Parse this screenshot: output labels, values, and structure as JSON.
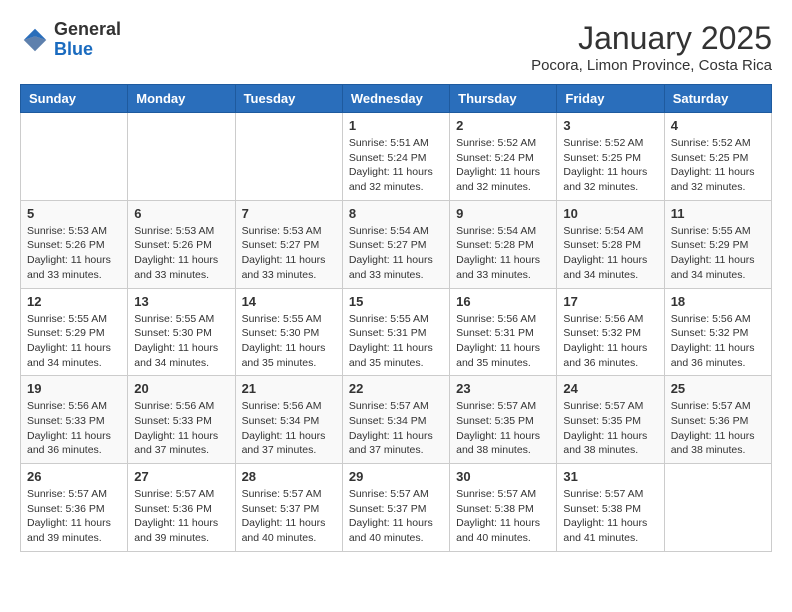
{
  "header": {
    "logo_general": "General",
    "logo_blue": "Blue",
    "month_title": "January 2025",
    "subtitle": "Pocora, Limon Province, Costa Rica"
  },
  "days_of_week": [
    "Sunday",
    "Monday",
    "Tuesday",
    "Wednesday",
    "Thursday",
    "Friday",
    "Saturday"
  ],
  "weeks": [
    [
      {
        "day": "",
        "sunrise": "",
        "sunset": "",
        "daylight": ""
      },
      {
        "day": "",
        "sunrise": "",
        "sunset": "",
        "daylight": ""
      },
      {
        "day": "",
        "sunrise": "",
        "sunset": "",
        "daylight": ""
      },
      {
        "day": "1",
        "sunrise": "Sunrise: 5:51 AM",
        "sunset": "Sunset: 5:24 PM",
        "daylight": "Daylight: 11 hours and 32 minutes."
      },
      {
        "day": "2",
        "sunrise": "Sunrise: 5:52 AM",
        "sunset": "Sunset: 5:24 PM",
        "daylight": "Daylight: 11 hours and 32 minutes."
      },
      {
        "day": "3",
        "sunrise": "Sunrise: 5:52 AM",
        "sunset": "Sunset: 5:25 PM",
        "daylight": "Daylight: 11 hours and 32 minutes."
      },
      {
        "day": "4",
        "sunrise": "Sunrise: 5:52 AM",
        "sunset": "Sunset: 5:25 PM",
        "daylight": "Daylight: 11 hours and 32 minutes."
      }
    ],
    [
      {
        "day": "5",
        "sunrise": "Sunrise: 5:53 AM",
        "sunset": "Sunset: 5:26 PM",
        "daylight": "Daylight: 11 hours and 33 minutes."
      },
      {
        "day": "6",
        "sunrise": "Sunrise: 5:53 AM",
        "sunset": "Sunset: 5:26 PM",
        "daylight": "Daylight: 11 hours and 33 minutes."
      },
      {
        "day": "7",
        "sunrise": "Sunrise: 5:53 AM",
        "sunset": "Sunset: 5:27 PM",
        "daylight": "Daylight: 11 hours and 33 minutes."
      },
      {
        "day": "8",
        "sunrise": "Sunrise: 5:54 AM",
        "sunset": "Sunset: 5:27 PM",
        "daylight": "Daylight: 11 hours and 33 minutes."
      },
      {
        "day": "9",
        "sunrise": "Sunrise: 5:54 AM",
        "sunset": "Sunset: 5:28 PM",
        "daylight": "Daylight: 11 hours and 33 minutes."
      },
      {
        "day": "10",
        "sunrise": "Sunrise: 5:54 AM",
        "sunset": "Sunset: 5:28 PM",
        "daylight": "Daylight: 11 hours and 34 minutes."
      },
      {
        "day": "11",
        "sunrise": "Sunrise: 5:55 AM",
        "sunset": "Sunset: 5:29 PM",
        "daylight": "Daylight: 11 hours and 34 minutes."
      }
    ],
    [
      {
        "day": "12",
        "sunrise": "Sunrise: 5:55 AM",
        "sunset": "Sunset: 5:29 PM",
        "daylight": "Daylight: 11 hours and 34 minutes."
      },
      {
        "day": "13",
        "sunrise": "Sunrise: 5:55 AM",
        "sunset": "Sunset: 5:30 PM",
        "daylight": "Daylight: 11 hours and 34 minutes."
      },
      {
        "day": "14",
        "sunrise": "Sunrise: 5:55 AM",
        "sunset": "Sunset: 5:30 PM",
        "daylight": "Daylight: 11 hours and 35 minutes."
      },
      {
        "day": "15",
        "sunrise": "Sunrise: 5:55 AM",
        "sunset": "Sunset: 5:31 PM",
        "daylight": "Daylight: 11 hours and 35 minutes."
      },
      {
        "day": "16",
        "sunrise": "Sunrise: 5:56 AM",
        "sunset": "Sunset: 5:31 PM",
        "daylight": "Daylight: 11 hours and 35 minutes."
      },
      {
        "day": "17",
        "sunrise": "Sunrise: 5:56 AM",
        "sunset": "Sunset: 5:32 PM",
        "daylight": "Daylight: 11 hours and 36 minutes."
      },
      {
        "day": "18",
        "sunrise": "Sunrise: 5:56 AM",
        "sunset": "Sunset: 5:32 PM",
        "daylight": "Daylight: 11 hours and 36 minutes."
      }
    ],
    [
      {
        "day": "19",
        "sunrise": "Sunrise: 5:56 AM",
        "sunset": "Sunset: 5:33 PM",
        "daylight": "Daylight: 11 hours and 36 minutes."
      },
      {
        "day": "20",
        "sunrise": "Sunrise: 5:56 AM",
        "sunset": "Sunset: 5:33 PM",
        "daylight": "Daylight: 11 hours and 37 minutes."
      },
      {
        "day": "21",
        "sunrise": "Sunrise: 5:56 AM",
        "sunset": "Sunset: 5:34 PM",
        "daylight": "Daylight: 11 hours and 37 minutes."
      },
      {
        "day": "22",
        "sunrise": "Sunrise: 5:57 AM",
        "sunset": "Sunset: 5:34 PM",
        "daylight": "Daylight: 11 hours and 37 minutes."
      },
      {
        "day": "23",
        "sunrise": "Sunrise: 5:57 AM",
        "sunset": "Sunset: 5:35 PM",
        "daylight": "Daylight: 11 hours and 38 minutes."
      },
      {
        "day": "24",
        "sunrise": "Sunrise: 5:57 AM",
        "sunset": "Sunset: 5:35 PM",
        "daylight": "Daylight: 11 hours and 38 minutes."
      },
      {
        "day": "25",
        "sunrise": "Sunrise: 5:57 AM",
        "sunset": "Sunset: 5:36 PM",
        "daylight": "Daylight: 11 hours and 38 minutes."
      }
    ],
    [
      {
        "day": "26",
        "sunrise": "Sunrise: 5:57 AM",
        "sunset": "Sunset: 5:36 PM",
        "daylight": "Daylight: 11 hours and 39 minutes."
      },
      {
        "day": "27",
        "sunrise": "Sunrise: 5:57 AM",
        "sunset": "Sunset: 5:36 PM",
        "daylight": "Daylight: 11 hours and 39 minutes."
      },
      {
        "day": "28",
        "sunrise": "Sunrise: 5:57 AM",
        "sunset": "Sunset: 5:37 PM",
        "daylight": "Daylight: 11 hours and 40 minutes."
      },
      {
        "day": "29",
        "sunrise": "Sunrise: 5:57 AM",
        "sunset": "Sunset: 5:37 PM",
        "daylight": "Daylight: 11 hours and 40 minutes."
      },
      {
        "day": "30",
        "sunrise": "Sunrise: 5:57 AM",
        "sunset": "Sunset: 5:38 PM",
        "daylight": "Daylight: 11 hours and 40 minutes."
      },
      {
        "day": "31",
        "sunrise": "Sunrise: 5:57 AM",
        "sunset": "Sunset: 5:38 PM",
        "daylight": "Daylight: 11 hours and 41 minutes."
      },
      {
        "day": "",
        "sunrise": "",
        "sunset": "",
        "daylight": ""
      }
    ]
  ]
}
